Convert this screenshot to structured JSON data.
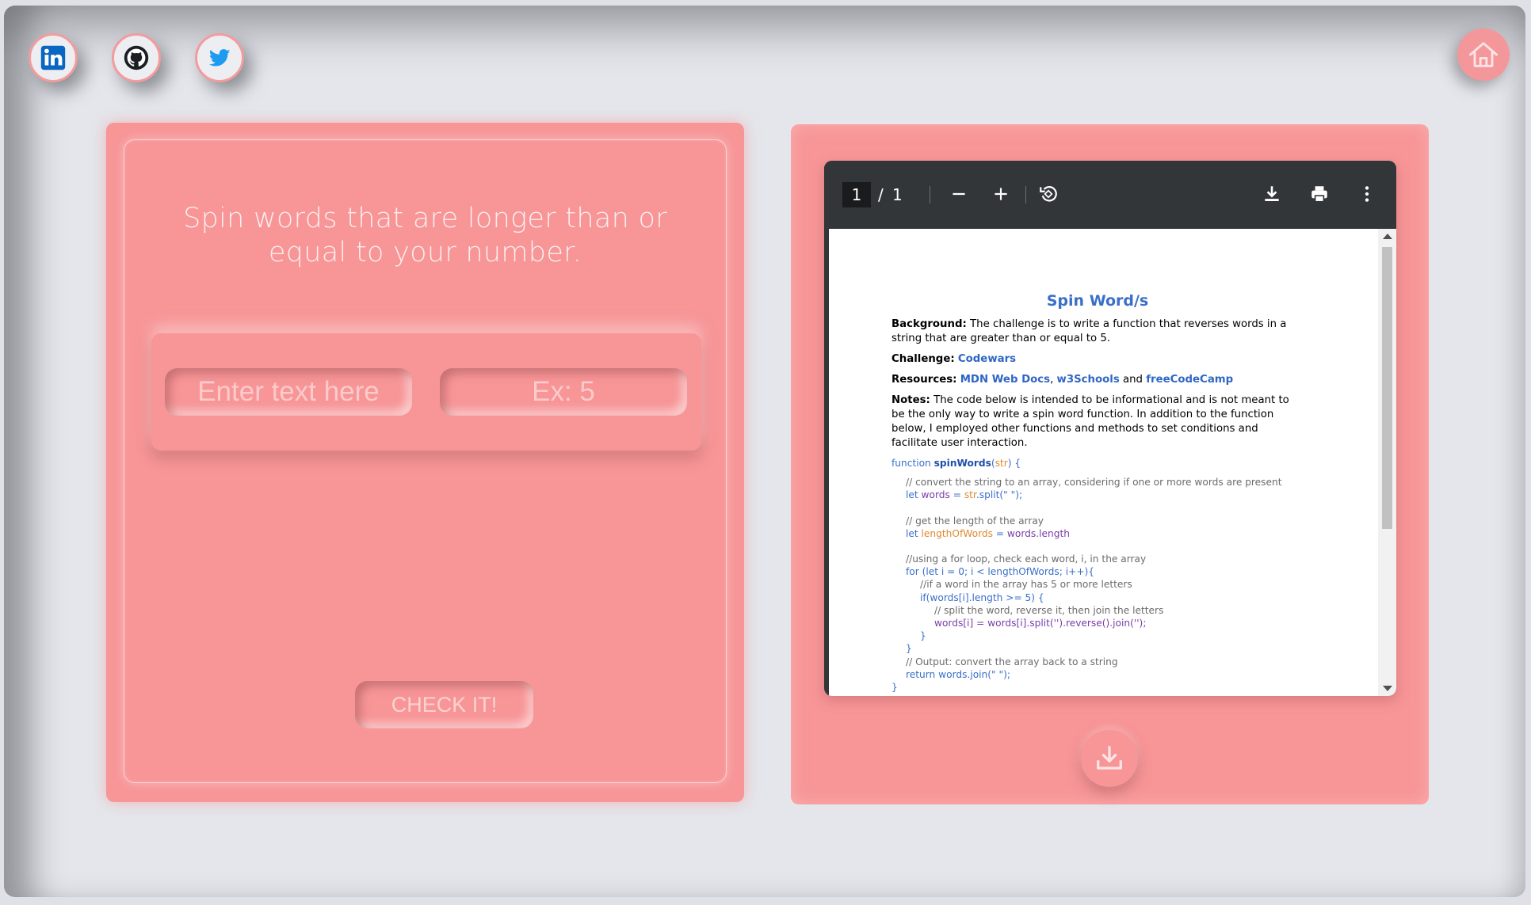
{
  "social": {
    "linkedin": "linkedin-icon",
    "github": "github-icon",
    "twitter": "twitter-icon"
  },
  "home": {
    "icon": "home-icon"
  },
  "colors": {
    "accent": "#f79597",
    "background": "#e4e6eb",
    "viewer_dark": "#323639",
    "link_blue": "#3a6fc9"
  },
  "left_panel": {
    "prompt": "Spin words that are longer than or equal to your number.",
    "text_input": {
      "placeholder": "Enter text here",
      "value": ""
    },
    "number_input": {
      "placeholder": "Ex: 5",
      "value": ""
    },
    "check_button": "CHECK IT!"
  },
  "pdf_viewer": {
    "page_current": "1",
    "page_separator": "/",
    "page_total": "1",
    "toolbar_icons": [
      "zoom-out-icon",
      "zoom-in-icon",
      "rotate-icon",
      "download-icon",
      "print-icon",
      "more-icon"
    ],
    "document": {
      "title": "Spin Word/s",
      "background_label": "Background:",
      "background_text": "The challenge is to write a function that reverses words in a string that are greater than or equal to 5.",
      "challenge_label": "Challenge:",
      "challenge_link": "Codewars",
      "resources_label": "Resources:",
      "resource_1": "MDN Web Docs",
      "resource_sep": ",",
      "resource_2": "w3Schools",
      "resource_and": "and",
      "resource_3": "freeCodeCamp",
      "notes_label": "Notes:",
      "notes_text": "The code below is intended to be informational and is not meant to be the only way to write a spin word function. In addition to the function below, I employed other functions and methods to set conditions and facilitate user interaction.",
      "code": {
        "l1_kw": "function",
        "l1_fn": "spinWords",
        "l1_open": "(",
        "l1_arg": "str",
        "l1_close": ") {",
        "l2": "// convert the string to an array, considering if one or more words are present",
        "l3_kw": "let",
        "l3_var": "words",
        "l3_eq": " = ",
        "l3_arg": "str",
        "l3_rest": ".split(\" \");",
        "l4": "// get the length of the array",
        "l5_kw": "let",
        "l5_var": "lengthOfWords",
        "l5_eq": " = ",
        "l5_rest": "words.length",
        "l6": "//using a for loop, check each word, i, in the array",
        "l7": "for (let i = 0; i < lengthOfWords; i++){",
        "l8": "//if a word in the array has 5 or more letters",
        "l9": "if(words[i].length >= 5) {",
        "l10": "// split the word, reverse it, then join the letters",
        "l11": "words[i] = words[i].split('').reverse().join('');",
        "l12": "}",
        "l13": "}",
        "l14": "// Output: convert the array back to a string",
        "l15": "return words.join(\" \");",
        "l16": "}"
      }
    }
  },
  "download_button": {
    "icon": "download-tray-icon"
  }
}
